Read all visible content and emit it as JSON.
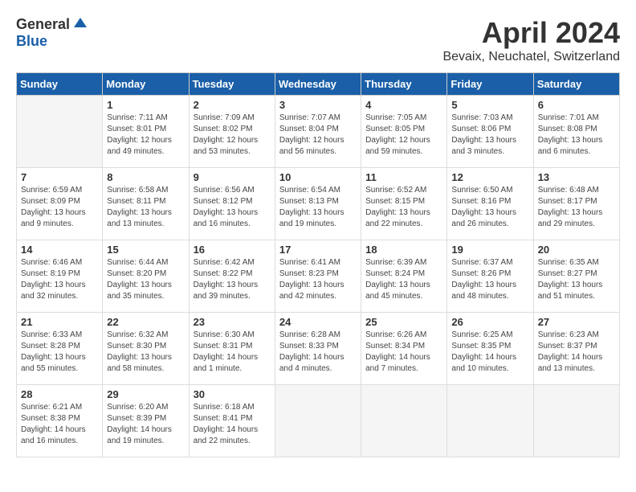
{
  "header": {
    "logo_general": "General",
    "logo_blue": "Blue",
    "title": "April 2024",
    "subtitle": "Bevaix, Neuchatel, Switzerland"
  },
  "days_of_week": [
    "Sunday",
    "Monday",
    "Tuesday",
    "Wednesday",
    "Thursday",
    "Friday",
    "Saturday"
  ],
  "weeks": [
    [
      {
        "day": "",
        "info": ""
      },
      {
        "day": "1",
        "info": "Sunrise: 7:11 AM\nSunset: 8:01 PM\nDaylight: 12 hours\nand 49 minutes."
      },
      {
        "day": "2",
        "info": "Sunrise: 7:09 AM\nSunset: 8:02 PM\nDaylight: 12 hours\nand 53 minutes."
      },
      {
        "day": "3",
        "info": "Sunrise: 7:07 AM\nSunset: 8:04 PM\nDaylight: 12 hours\nand 56 minutes."
      },
      {
        "day": "4",
        "info": "Sunrise: 7:05 AM\nSunset: 8:05 PM\nDaylight: 12 hours\nand 59 minutes."
      },
      {
        "day": "5",
        "info": "Sunrise: 7:03 AM\nSunset: 8:06 PM\nDaylight: 13 hours\nand 3 minutes."
      },
      {
        "day": "6",
        "info": "Sunrise: 7:01 AM\nSunset: 8:08 PM\nDaylight: 13 hours\nand 6 minutes."
      }
    ],
    [
      {
        "day": "7",
        "info": "Sunrise: 6:59 AM\nSunset: 8:09 PM\nDaylight: 13 hours\nand 9 minutes."
      },
      {
        "day": "8",
        "info": "Sunrise: 6:58 AM\nSunset: 8:11 PM\nDaylight: 13 hours\nand 13 minutes."
      },
      {
        "day": "9",
        "info": "Sunrise: 6:56 AM\nSunset: 8:12 PM\nDaylight: 13 hours\nand 16 minutes."
      },
      {
        "day": "10",
        "info": "Sunrise: 6:54 AM\nSunset: 8:13 PM\nDaylight: 13 hours\nand 19 minutes."
      },
      {
        "day": "11",
        "info": "Sunrise: 6:52 AM\nSunset: 8:15 PM\nDaylight: 13 hours\nand 22 minutes."
      },
      {
        "day": "12",
        "info": "Sunrise: 6:50 AM\nSunset: 8:16 PM\nDaylight: 13 hours\nand 26 minutes."
      },
      {
        "day": "13",
        "info": "Sunrise: 6:48 AM\nSunset: 8:17 PM\nDaylight: 13 hours\nand 29 minutes."
      }
    ],
    [
      {
        "day": "14",
        "info": "Sunrise: 6:46 AM\nSunset: 8:19 PM\nDaylight: 13 hours\nand 32 minutes."
      },
      {
        "day": "15",
        "info": "Sunrise: 6:44 AM\nSunset: 8:20 PM\nDaylight: 13 hours\nand 35 minutes."
      },
      {
        "day": "16",
        "info": "Sunrise: 6:42 AM\nSunset: 8:22 PM\nDaylight: 13 hours\nand 39 minutes."
      },
      {
        "day": "17",
        "info": "Sunrise: 6:41 AM\nSunset: 8:23 PM\nDaylight: 13 hours\nand 42 minutes."
      },
      {
        "day": "18",
        "info": "Sunrise: 6:39 AM\nSunset: 8:24 PM\nDaylight: 13 hours\nand 45 minutes."
      },
      {
        "day": "19",
        "info": "Sunrise: 6:37 AM\nSunset: 8:26 PM\nDaylight: 13 hours\nand 48 minutes."
      },
      {
        "day": "20",
        "info": "Sunrise: 6:35 AM\nSunset: 8:27 PM\nDaylight: 13 hours\nand 51 minutes."
      }
    ],
    [
      {
        "day": "21",
        "info": "Sunrise: 6:33 AM\nSunset: 8:28 PM\nDaylight: 13 hours\nand 55 minutes."
      },
      {
        "day": "22",
        "info": "Sunrise: 6:32 AM\nSunset: 8:30 PM\nDaylight: 13 hours\nand 58 minutes."
      },
      {
        "day": "23",
        "info": "Sunrise: 6:30 AM\nSunset: 8:31 PM\nDaylight: 14 hours\nand 1 minute."
      },
      {
        "day": "24",
        "info": "Sunrise: 6:28 AM\nSunset: 8:33 PM\nDaylight: 14 hours\nand 4 minutes."
      },
      {
        "day": "25",
        "info": "Sunrise: 6:26 AM\nSunset: 8:34 PM\nDaylight: 14 hours\nand 7 minutes."
      },
      {
        "day": "26",
        "info": "Sunrise: 6:25 AM\nSunset: 8:35 PM\nDaylight: 14 hours\nand 10 minutes."
      },
      {
        "day": "27",
        "info": "Sunrise: 6:23 AM\nSunset: 8:37 PM\nDaylight: 14 hours\nand 13 minutes."
      }
    ],
    [
      {
        "day": "28",
        "info": "Sunrise: 6:21 AM\nSunset: 8:38 PM\nDaylight: 14 hours\nand 16 minutes."
      },
      {
        "day": "29",
        "info": "Sunrise: 6:20 AM\nSunset: 8:39 PM\nDaylight: 14 hours\nand 19 minutes."
      },
      {
        "day": "30",
        "info": "Sunrise: 6:18 AM\nSunset: 8:41 PM\nDaylight: 14 hours\nand 22 minutes."
      },
      {
        "day": "",
        "info": ""
      },
      {
        "day": "",
        "info": ""
      },
      {
        "day": "",
        "info": ""
      },
      {
        "day": "",
        "info": ""
      }
    ]
  ]
}
